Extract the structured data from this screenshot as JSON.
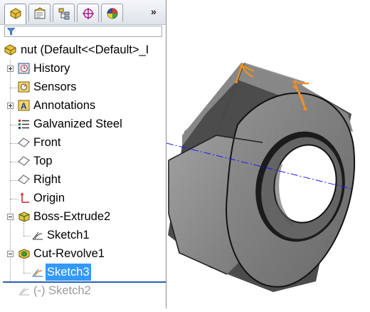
{
  "tabs": [
    {
      "name": "featuremanager-tab",
      "active": true
    },
    {
      "name": "propertymanager-tab",
      "active": false
    },
    {
      "name": "configurationmanager-tab",
      "active": false
    },
    {
      "name": "dimxpert-tab",
      "active": false
    },
    {
      "name": "display-manager-tab",
      "active": false
    }
  ],
  "more_label": "»",
  "tree": {
    "root": "nut  (Default<<Default>_I",
    "items": [
      {
        "label": "History",
        "icon": "history-icon",
        "expander": "plus"
      },
      {
        "label": "Sensors",
        "icon": "sensors-icon"
      },
      {
        "label": "Annotations",
        "icon": "annotations-icon",
        "expander": "plus"
      },
      {
        "label": "Galvanized Steel",
        "icon": "material-icon"
      },
      {
        "label": "Front",
        "icon": "plane-icon"
      },
      {
        "label": "Top",
        "icon": "plane-icon"
      },
      {
        "label": "Right",
        "icon": "plane-icon"
      },
      {
        "label": "Origin",
        "icon": "origin-icon"
      },
      {
        "label": "Boss-Extrude2",
        "icon": "boss-extrude-icon",
        "expander": "minus"
      },
      {
        "label": "Sketch1",
        "icon": "sketch-icon"
      },
      {
        "label": "Cut-Revolve1",
        "icon": "cut-revolve-icon",
        "expander": "minus"
      },
      {
        "label": "Sketch3",
        "icon": "sketch-icon",
        "selected": true
      },
      {
        "label": "(-) Sketch2",
        "icon": "sketch-icon",
        "suppressed": true
      }
    ]
  },
  "colors": {
    "selection": "#3399ff",
    "axis_line": "#1a1aff",
    "sketch_highlight": "#f0901e",
    "rollback_bar": "#2a5fb8"
  }
}
